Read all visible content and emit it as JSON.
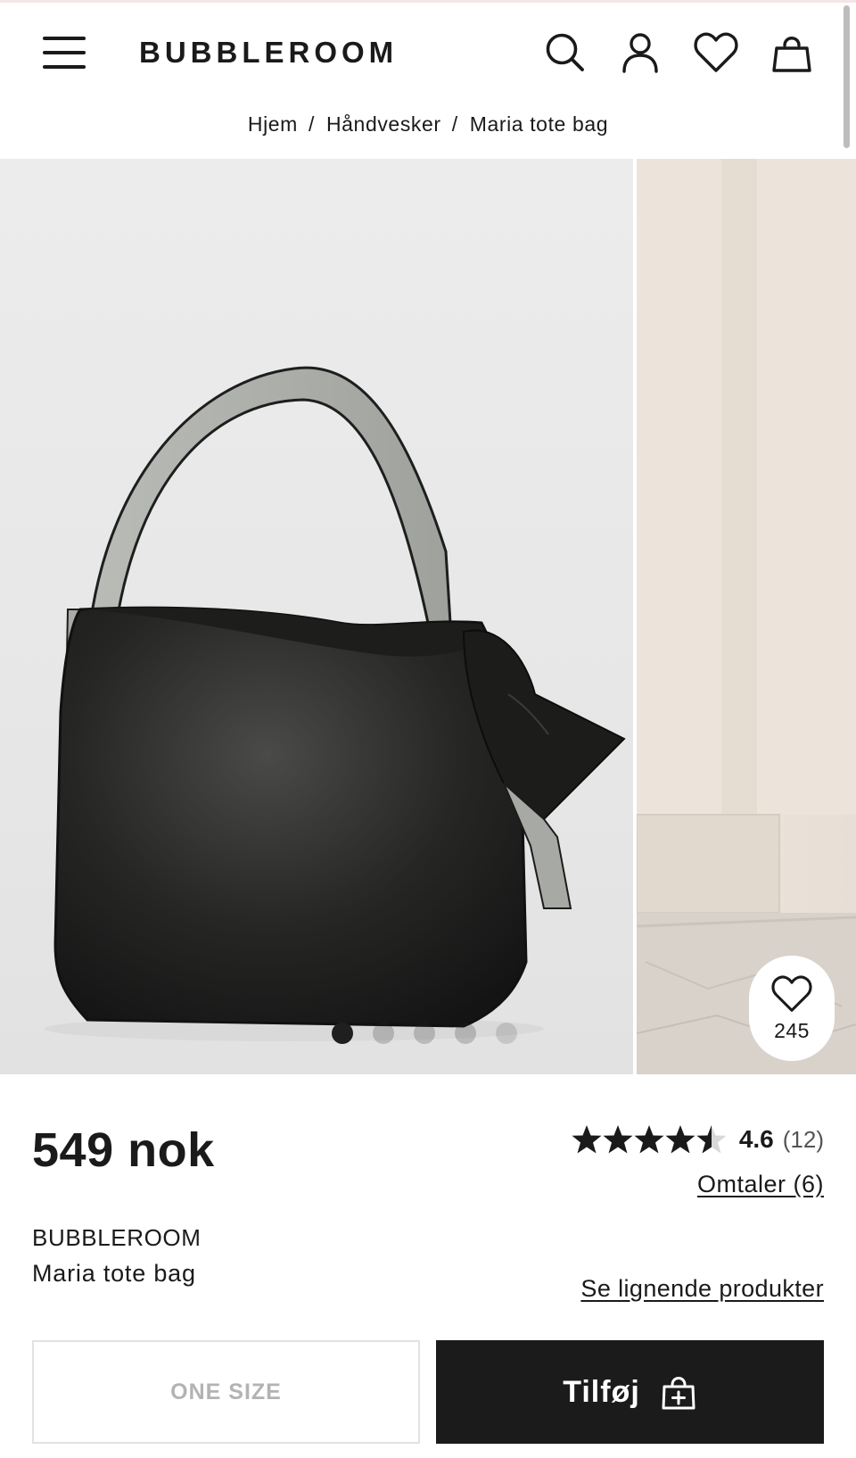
{
  "header": {
    "logo": "BUBBLEROOM",
    "icons": [
      "menu-icon",
      "search-icon",
      "account-icon",
      "heart-icon",
      "bag-icon"
    ]
  },
  "breadcrumb": {
    "items": [
      "Hjem",
      "Håndvesker",
      "Maria tote bag"
    ],
    "separator": "/"
  },
  "gallery": {
    "image_count": 5,
    "active_index": 0,
    "favorites_count": "245"
  },
  "product": {
    "price": "549 nok",
    "rating_value": "4.6",
    "rating_stars": 4.6,
    "rating_count": "(12)",
    "reviews_link": "Omtaler (6)",
    "brand": "BUBBLEROOM",
    "name": "Maria tote bag",
    "similar_link": "Se lignende produkter"
  },
  "actions": {
    "size_label": "ONE SIZE",
    "add_label": "Tilføj"
  },
  "colors": {
    "text": "#1a1a1a",
    "button_dark": "#1b1b1b",
    "muted": "#b3b3b3"
  }
}
